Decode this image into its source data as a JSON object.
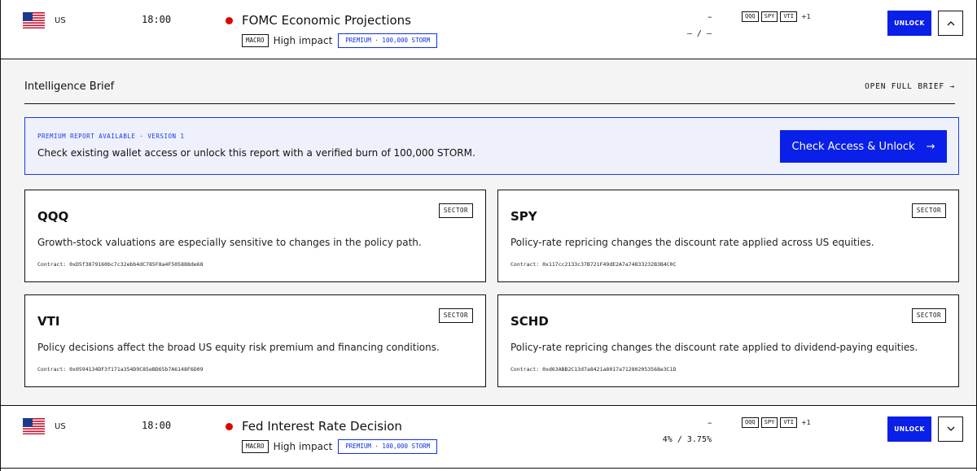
{
  "events": [
    {
      "country": "US",
      "time": "18:00",
      "title": "FOMC Economic Projections",
      "category_tag": "MACRO",
      "impact": "High impact",
      "premium_tag": "PREMIUM · 100,000 STORM",
      "actual": "–",
      "forecast_previous": "– / –",
      "tickers": [
        "QQQ",
        "SPY",
        "VTI"
      ],
      "tickers_more": "+1",
      "unlock_label": "UNLOCK",
      "expanded": true
    },
    {
      "country": "US",
      "time": "18:00",
      "title": "Fed Interest Rate Decision",
      "category_tag": "MACRO",
      "impact": "High impact",
      "premium_tag": "PREMIUM · 100,000 STORM",
      "actual": "–",
      "forecast_previous": "4% / 3.75%",
      "tickers": [
        "QQQ",
        "SPY",
        "VTI"
      ],
      "tickers_more": "+1",
      "unlock_label": "UNLOCK",
      "expanded": false
    }
  ],
  "brief": {
    "title": "Intelligence Brief",
    "open_full_label": "OPEN FULL BRIEF →",
    "premium": {
      "label": "PREMIUM REPORT AVAILABLE · VERSION 1",
      "text": "Check existing wallet access or unlock this report with a verified burn of 100,000 STORM.",
      "button_label": "Check Access & Unlock",
      "button_arrow": "→"
    },
    "cards": [
      {
        "ticker": "QQQ",
        "badge": "SECTOR",
        "description": "Growth-stock valuations are especially sensitive to changes in the policy path.",
        "contract": "Contract: 0xD5f3879160bc7c32ebb4dC785F8a4F505888de68"
      },
      {
        "ticker": "SPY",
        "badge": "SECTOR",
        "description": "Policy-rate repricing changes the discount rate applied across US equities.",
        "contract": "Contract: 0x117cc2133c37B721F49dE2A7a74833232B3B4C0C"
      },
      {
        "ticker": "VTI",
        "badge": "SECTOR",
        "description": "Policy decisions affect the broad US equity risk premium and financing conditions.",
        "contract": "Contract: 0x0594134DF3f171a354D9C85eBD65b7A6148F6D09"
      },
      {
        "ticker": "SCHD",
        "badge": "SECTOR",
        "description": "Policy-rate repricing changes the discount rate applied to dividend-paying equities.",
        "contract": "Contract: 0xd63ABB2C13d7a8421a8017a712802053568e3C1D"
      }
    ]
  },
  "colors": {
    "accent": "#0a1fe8",
    "impact_dot": "#e00000",
    "panel_bg": "#f4f4f4",
    "premium_bg": "#eef1fb"
  },
  "icons": {
    "flag": "us-flag-icon",
    "chevron_up": "chevron-up-icon",
    "chevron_down": "chevron-down-icon",
    "arrow_right": "arrow-right-icon"
  }
}
